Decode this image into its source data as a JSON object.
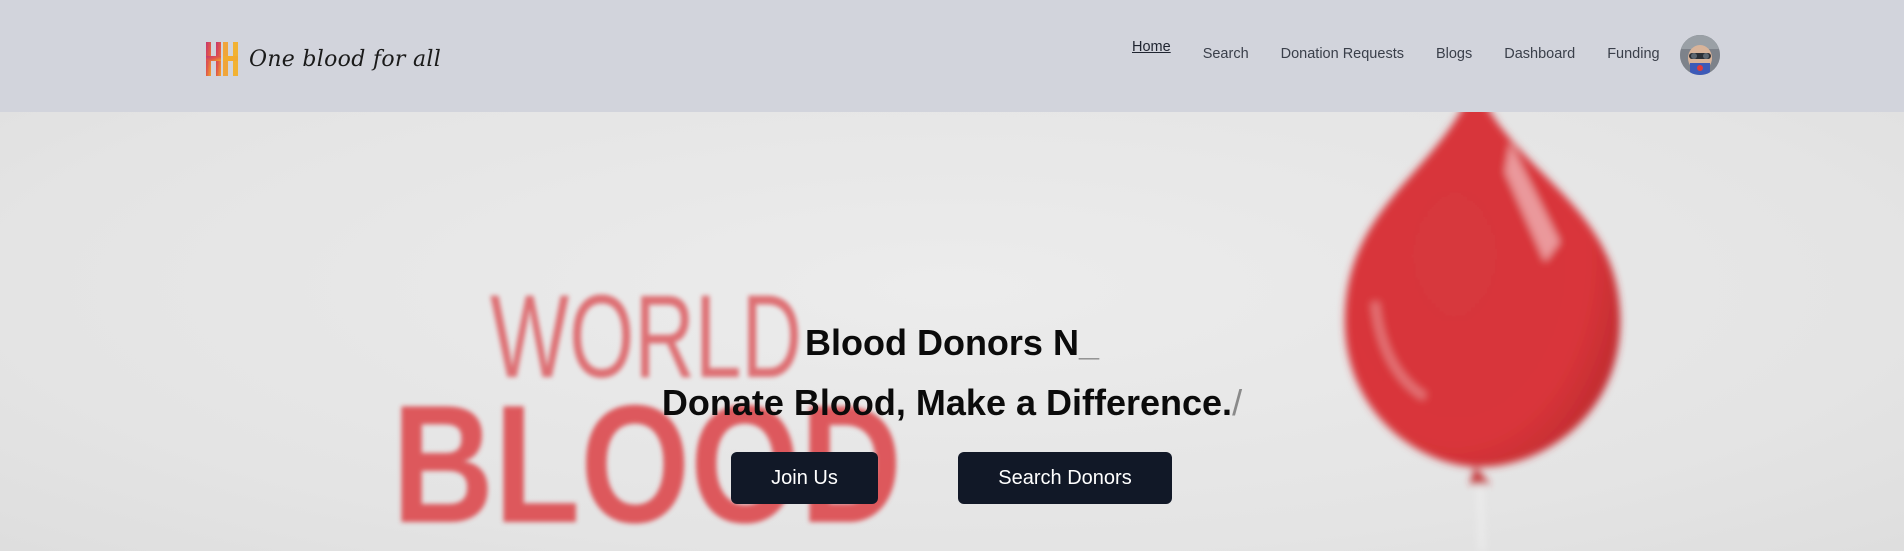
{
  "navbar": {
    "brand_name": "One blood for all",
    "logo_icon": "hh-logo-icon",
    "links": [
      {
        "label": "Home",
        "active": true
      },
      {
        "label": "Search",
        "active": false
      },
      {
        "label": "Donation Requests",
        "active": false
      },
      {
        "label": "Blogs",
        "active": false
      },
      {
        "label": "Dashboard",
        "active": false
      },
      {
        "label": "Funding",
        "active": false
      }
    ],
    "avatar_icon": "user-avatar"
  },
  "hero": {
    "title": "Blood Donors N",
    "title_cursor": "_",
    "subtitle": "Donate Blood, Make a Difference.",
    "subtitle_cursor": "/",
    "join_label": "Join Us",
    "search_label": "Search Donors",
    "background_text": {
      "line1": "WORLD",
      "line2": "BLOOD"
    }
  },
  "colors": {
    "navbar_bg": "#d2d4dc",
    "hero_bg": "#e6e6e7",
    "button_bg": "#111827",
    "accent_red": "#e23b3b"
  }
}
